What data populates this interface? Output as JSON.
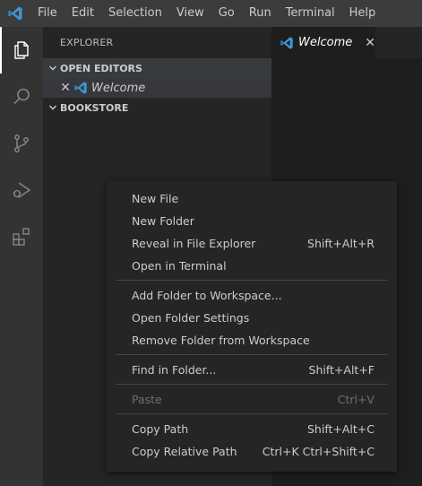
{
  "menubar": {
    "items": [
      "File",
      "Edit",
      "Selection",
      "View",
      "Go",
      "Run",
      "Terminal",
      "Help"
    ]
  },
  "activity_bar": {
    "items": [
      {
        "name": "explorer-icon",
        "active": true
      },
      {
        "name": "search-icon",
        "active": false
      },
      {
        "name": "source-control-icon",
        "active": false
      },
      {
        "name": "run-debug-icon",
        "active": false
      },
      {
        "name": "extensions-icon",
        "active": false
      }
    ]
  },
  "sidebar": {
    "title": "EXPLORER",
    "open_editors": {
      "header": "OPEN EDITORS",
      "items": [
        {
          "label": "Welcome"
        }
      ]
    },
    "folder": {
      "header": "BOOKSTORE"
    }
  },
  "editor": {
    "tabs": [
      {
        "label": "Welcome"
      }
    ]
  },
  "context_menu": {
    "groups": [
      [
        {
          "label": "New File",
          "shortcut": "",
          "enabled": true
        },
        {
          "label": "New Folder",
          "shortcut": "",
          "enabled": true
        },
        {
          "label": "Reveal in File Explorer",
          "shortcut": "Shift+Alt+R",
          "enabled": true
        },
        {
          "label": "Open in Terminal",
          "shortcut": "",
          "enabled": true
        }
      ],
      [
        {
          "label": "Add Folder to Workspace...",
          "shortcut": "",
          "enabled": true
        },
        {
          "label": "Open Folder Settings",
          "shortcut": "",
          "enabled": true
        },
        {
          "label": "Remove Folder from Workspace",
          "shortcut": "",
          "enabled": true
        }
      ],
      [
        {
          "label": "Find in Folder...",
          "shortcut": "Shift+Alt+F",
          "enabled": true
        }
      ],
      [
        {
          "label": "Paste",
          "shortcut": "Ctrl+V",
          "enabled": false
        }
      ],
      [
        {
          "label": "Copy Path",
          "shortcut": "Shift+Alt+C",
          "enabled": true
        },
        {
          "label": "Copy Relative Path",
          "shortcut": "Ctrl+K Ctrl+Shift+C",
          "enabled": true
        }
      ]
    ]
  },
  "colors": {
    "accent": "#3c99d4",
    "titlebar": "#3c3c3c",
    "activitybar": "#333333",
    "sidebar": "#252526",
    "editor": "#1e1e1e"
  }
}
